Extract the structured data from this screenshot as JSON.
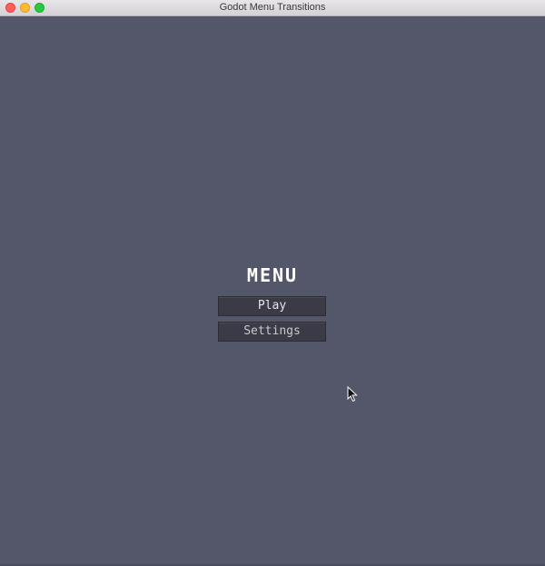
{
  "window": {
    "title": "Godot Menu Transitions",
    "controls": [
      "close",
      "minimize",
      "zoom"
    ]
  },
  "menu": {
    "title": "MENU",
    "buttons": {
      "play_label": "Play",
      "settings_label": "Settings"
    }
  },
  "colors": {
    "background": "#54566a",
    "button": "#3b3b47",
    "text": "#ffffff"
  },
  "icons": {
    "cursor": "mouse-pointer-icon"
  }
}
